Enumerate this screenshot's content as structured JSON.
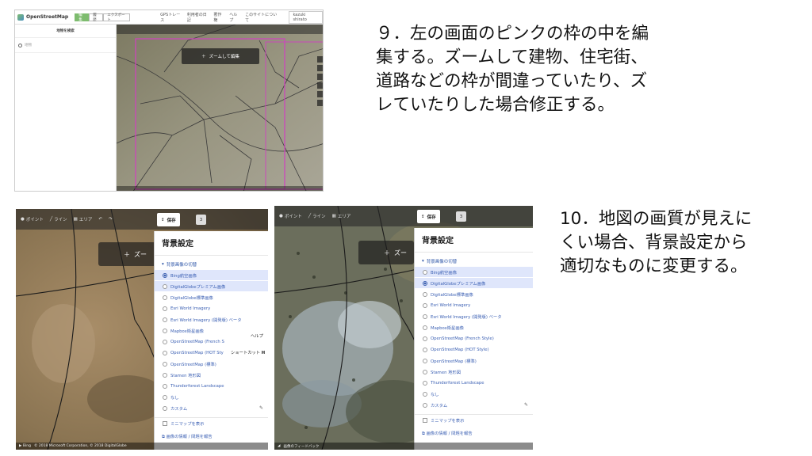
{
  "top_screenshot": {
    "header": {
      "logo_text": "OpenStreetMap",
      "buttons": [
        "編集",
        "履歴",
        "エクスポート"
      ],
      "active_button": 0,
      "nav": [
        "GPSトレース",
        "利用者の日記",
        "著作権",
        "ヘルプ",
        "このサイトについて"
      ],
      "user": "kazuki shirato"
    },
    "sidebar": {
      "title": "地物を検索",
      "search_placeholder": "地物"
    },
    "map": {
      "zoom_banner": "ズームして編集"
    }
  },
  "bottom_left": {
    "toolbar": [
      "ポイント",
      "ライン",
      "エリア"
    ],
    "save_label": "保存",
    "edit_count": "3",
    "zoom_banner": "ズー",
    "panel": {
      "title": "背景設定",
      "section": "背景画像の切替",
      "options": [
        "Bing航空画像",
        "DigitalGlobeプレミアム画像",
        "DigitalGlobe標準画像",
        "Esri World Imagery",
        "Esri World Imagery (開発版) ベータ",
        "Mapbox衛星画像",
        "OpenStreetMap (French S",
        "OpenStreetMap (HOT Sty",
        "OpenStreetMap (標準)",
        "Stamen 地形図",
        "Thunderforest Landscape",
        "なし",
        "カスタム"
      ],
      "selected": 0,
      "minimap": "ミニマップを表示",
      "report": "画像の情報 / 問題を報告",
      "help_label": "ヘルプ",
      "shortcut_label": "ショートカット",
      "shortcut_key": "H"
    },
    "attribution": "© 2018 Microsoft Corporation, © 2018 DigitalGlobe"
  },
  "bottom_right": {
    "toolbar": [
      "ポイント",
      "ライン",
      "エリア"
    ],
    "save_label": "保存",
    "edit_count": "3",
    "zoom_banner": "ズー",
    "panel": {
      "title": "背景設定",
      "section": "背景画像の切替",
      "options": [
        "Bing航空画像",
        "DigitalGlobeプレミアム画像",
        "DigitalGlobe標準画像",
        "Esri World Imagery",
        "Esri World Imagery (開発版) ベータ",
        "Mapbox衛星画像",
        "OpenStreetMap (French Style)",
        "OpenStreetMap (HOT Style)",
        "OpenStreetMap (標準)",
        "Stamen 地形図",
        "Thunderforest Landscape",
        "なし",
        "カスタム"
      ],
      "selected": 1,
      "minimap": "ミニマップを表示",
      "report": "画像の情報 / 問題を報告"
    },
    "attribution": "画像のフィードバック"
  },
  "captions": {
    "step9": [
      "９．左の画面のピンクの枠の中を編",
      "集する。ズームして建物、住宅街、",
      "道路などの枠が間違っていたり、ズ",
      "レていたりした場合修正する。"
    ],
    "step10": [
      "10．地図の画質が見えに",
      "くい場合、背景設定から",
      "適切なものに変更する。"
    ]
  }
}
